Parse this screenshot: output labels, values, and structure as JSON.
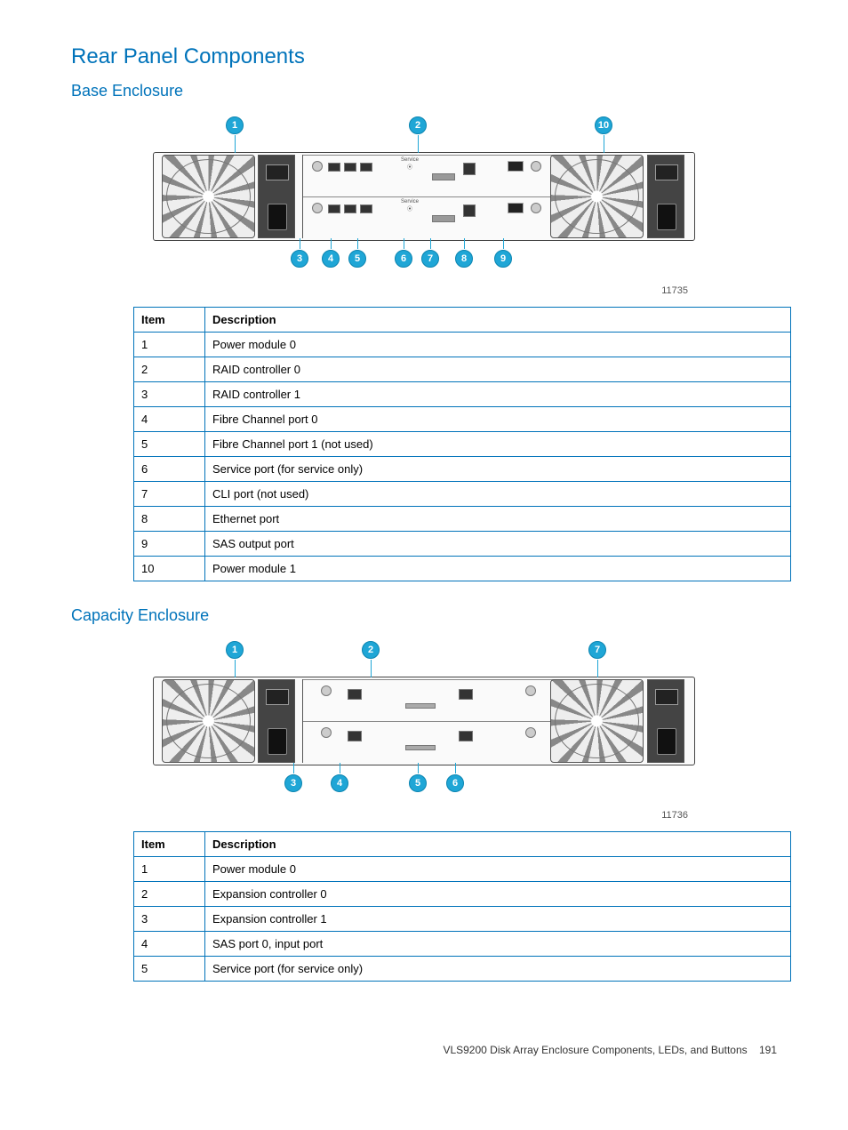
{
  "headings": {
    "main": "Rear Panel Components",
    "sub1": "Base Enclosure",
    "sub2": "Capacity Enclosure"
  },
  "figure1": {
    "callouts_top": [
      "1",
      "2",
      "10"
    ],
    "callouts_bottom": [
      "3",
      "4",
      "5",
      "6",
      "7",
      "8",
      "9"
    ],
    "caption": "11735"
  },
  "figure2": {
    "callouts_top": [
      "1",
      "2",
      "7"
    ],
    "callouts_bottom": [
      "3",
      "4",
      "5",
      "6"
    ],
    "caption": "11736"
  },
  "table1": {
    "headers": {
      "item": "Item",
      "desc": "Description"
    },
    "rows": [
      {
        "item": "1",
        "desc": "Power module 0"
      },
      {
        "item": "2",
        "desc": "RAID controller 0"
      },
      {
        "item": "3",
        "desc": "RAID controller 1"
      },
      {
        "item": "4",
        "desc": "Fibre Channel port 0"
      },
      {
        "item": "5",
        "desc": "Fibre Channel port 1 (not used)"
      },
      {
        "item": "6",
        "desc": "Service port (for service only)"
      },
      {
        "item": "7",
        "desc": "CLI port (not used)"
      },
      {
        "item": "8",
        "desc": "Ethernet port"
      },
      {
        "item": "9",
        "desc": "SAS output port"
      },
      {
        "item": "10",
        "desc": "Power module 1"
      }
    ]
  },
  "table2": {
    "headers": {
      "item": "Item",
      "desc": "Description"
    },
    "rows": [
      {
        "item": "1",
        "desc": "Power module 0"
      },
      {
        "item": "2",
        "desc": "Expansion controller 0"
      },
      {
        "item": "3",
        "desc": "Expansion controller 1"
      },
      {
        "item": "4",
        "desc": "SAS port 0, input port"
      },
      {
        "item": "5",
        "desc": "Service port (for service only)"
      }
    ]
  },
  "footer": {
    "text": "VLS9200 Disk Array Enclosure Components, LEDs, and Buttons",
    "page": "191"
  }
}
